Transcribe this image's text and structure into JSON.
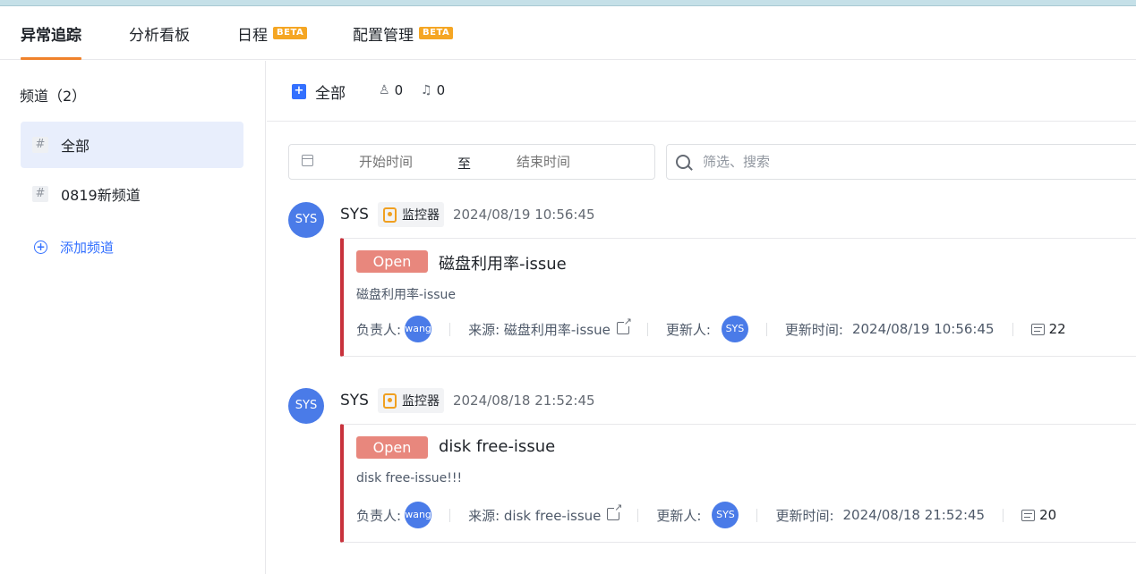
{
  "tabs": [
    {
      "label": "异常追踪",
      "badge": ""
    },
    {
      "label": "分析看板",
      "badge": ""
    },
    {
      "label": "日程",
      "badge": "BETA"
    },
    {
      "label": "配置管理",
      "badge": "BETA"
    }
  ],
  "sidebar": {
    "title": "频道（2）",
    "channels": [
      {
        "label": "全部"
      },
      {
        "label": "0819新频道"
      }
    ],
    "add_label": "添加频道"
  },
  "header": {
    "title": "全部",
    "members": "0",
    "subscribers": "0"
  },
  "filters": {
    "start_placeholder": "开始时间",
    "to_label": "至",
    "end_placeholder": "结束时间",
    "search_placeholder": "筛选、搜索"
  },
  "issues": [
    {
      "avatar": "SYS",
      "author": "SYS",
      "source_tag": "监控器",
      "time": "2024/08/19 10:56:45",
      "status": "Open",
      "title": "磁盘利用率-issue",
      "description": "磁盘利用率-issue",
      "assignee_label": "负责人:",
      "assignee": "wang",
      "source_label": "来源: 磁盘利用率-issue",
      "updater_label": "更新人:",
      "updater": "SYS",
      "updated_label": "更新时间:",
      "updated_time": "2024/08/19 10:56:45",
      "count": "22"
    },
    {
      "avatar": "SYS",
      "author": "SYS",
      "source_tag": "监控器",
      "time": "2024/08/18 21:52:45",
      "status": "Open",
      "title": "disk free-issue",
      "description": "disk free-issue!!!",
      "assignee_label": "负责人:",
      "assignee": "wang",
      "source_label": "来源: disk free-issue",
      "updater_label": "更新人:",
      "updater": "SYS",
      "updated_label": "更新时间:",
      "updated_time": "2024/08/18 21:52:45",
      "count": "20"
    }
  ],
  "colors": {
    "accent": "#f0822b",
    "brand_blue": "#3370ff",
    "status_open": "#e8877d",
    "card_border": "#c8323c"
  }
}
